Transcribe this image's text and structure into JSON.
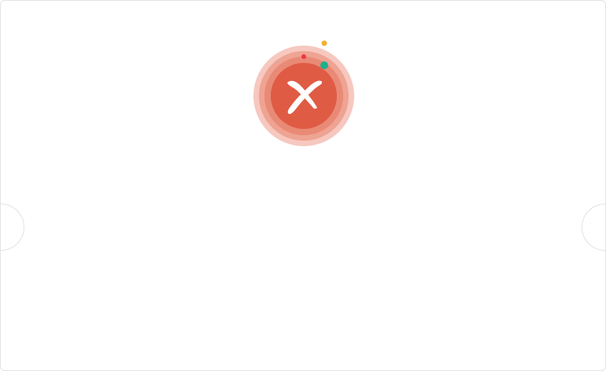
{
  "status": {
    "icon": "error-x-icon",
    "colors": {
      "outer_ring": "#f6c8bf",
      "middle_ring": "#efa393",
      "inner_ring": "#e98a76",
      "core": "#e05b44",
      "mark": "#ffffff",
      "dot_red": "#f0383d",
      "dot_yellow": "#f2b233",
      "dot_green": "#1bb18c"
    }
  }
}
